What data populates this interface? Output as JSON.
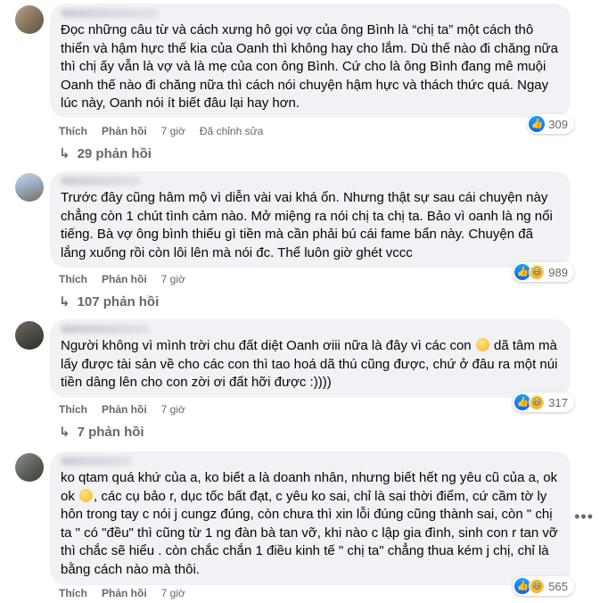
{
  "comments": [
    {
      "text": "Đọc những câu từ và cách xưng hô gọi vợ của ông Bình là “chị ta” một cách thô thiển và hậm hực thế kia của Oanh thì không hay cho lắm. Dù thế nào đi chăng nữa thì chị ấy vẫn là vợ và là mẹ của con ông Bình. Cứ cho là ông Bình đang mê muội Oanh thế nào đi chăng nữa thì cách nói chuyện hậm hực và thách thức quá. Ngay lúc này, Oanh nói ít biết đâu lại hay hơn.",
      "reaction_count": "309",
      "reaction_icons": [
        "like-icon"
      ],
      "like_label": "Thích",
      "reply_label": "Phản hồi",
      "time": "7 giờ",
      "edited": "Đã chỉnh sửa",
      "replies_label": "29 phản hồi"
    },
    {
      "text": "Trước đây cũng hâm mộ vì diễn vài vai khá ổn. Nhưng thật sự sau cái chuyện này chẳng còn 1 chút tình cảm nào. Mở miệng ra nói chị ta chị ta. Bảo vì oanh là ng nổi tiếng. Bà vợ ông bình thiếu gì tiền mà cần phải bú cái fame bẩn này. Chuyện đã lắng xuống rồi còn lôi lên mà nói đc. Thể luôn giờ ghét vccc",
      "reaction_count": "989",
      "reaction_icons": [
        "like-icon",
        "haha-icon"
      ],
      "like_label": "Thích",
      "reply_label": "Phản hồi",
      "time": "7 giờ",
      "replies_label": "107 phản hồi"
    },
    {
      "text_before": "Người không vì mình trời chu đất diệt Oanh ơiii nữa là đây vì các con ",
      "text_after": " dã tâm mà lấy được tài sản về cho các con thì tao hoá dã thú cũng được, chứ ở đâu ra một núi tiền dâng lên cho con zời ơi đất hỡi được :))))",
      "reaction_count": "317",
      "reaction_icons": [
        "like-icon",
        "haha-icon"
      ],
      "like_label": "Thích",
      "reply_label": "Phản hồi",
      "time": "7 giờ",
      "replies_label": "7 phản hồi"
    },
    {
      "text_before": "ko qtam quá khứ của a, ko biết a là doanh nhân, nhưng biết hết ng yêu cũ của a, ok ok ",
      "text_after": ", các cụ bảo r, dục tốc bất đạt, c yêu ko sai, chỉ là sai thời điểm, cứ cầm tờ ly hôn trong tay c nói j cungz đúng, còn chưa thì xin lỗi đúng cũng thành sai, còn \" chị ta \" có \"đều\" thì cũng từ 1 ng đàn bà tan vỡ, khi nào c lập gia đình, sinh con r tan vỡ thì chắc sẽ hiểu . còn chắc chắn 1 điều kinh tế \" chị ta\" chẳng thua kém j chị, chỉ là bằng cách nào mà thôi.",
      "reaction_count": "565",
      "reaction_icons": [
        "like-icon",
        "haha-icon"
      ],
      "like_label": "Thích",
      "reply_label": "Phản hồi",
      "time": "7 giờ"
    }
  ],
  "more_button": "•••",
  "reply_arrow": "↳"
}
